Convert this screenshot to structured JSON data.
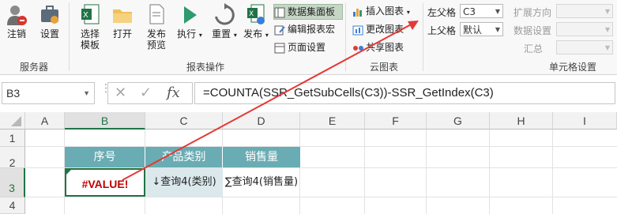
{
  "ribbon": {
    "groups": {
      "server": {
        "label": "服务器",
        "buttons": [
          "注销",
          "设置"
        ]
      },
      "report_ops": {
        "label": "报表操作",
        "buttons": [
          {
            "name": "select-template",
            "l1": "选择",
            "l2": "模板"
          },
          {
            "name": "open",
            "l1": "打开",
            "l2": ""
          },
          {
            "name": "publish-preview",
            "l1": "发布",
            "l2": "预览"
          },
          {
            "name": "run",
            "l1": "执行",
            "l2": ""
          },
          {
            "name": "reset",
            "l1": "重置",
            "l2": ""
          },
          {
            "name": "publish",
            "l1": "发布",
            "l2": ""
          }
        ],
        "small": [
          "数据集面板",
          "编辑报表宏",
          "页面设置"
        ]
      },
      "cloud_chart": {
        "label": "云图表",
        "small": [
          "插入图表",
          "更改图表",
          "共享图表"
        ]
      },
      "cell_settings": {
        "label": "单元格设置",
        "left_parent_label": "左父格",
        "left_parent_value": "C3",
        "top_parent_label": "上父格",
        "top_parent_value": "默认",
        "expand_label": "扩展方向",
        "data_settings_label": "数据设置",
        "summary_label": "汇总"
      }
    }
  },
  "formula_bar": {
    "name_box": "B3",
    "fx": "fx",
    "formula": "=COUNTA(SSR_GetSubCells(C3))-SSR_GetIndex(C3)"
  },
  "sheet": {
    "columns": [
      "A",
      "B",
      "C",
      "D",
      "E",
      "F",
      "G",
      "H",
      "I"
    ],
    "rows": [
      "1",
      "2",
      "3",
      "4"
    ],
    "header_cells": [
      "序号",
      "产品类别",
      "销售量"
    ],
    "b3": "#VALUE!",
    "c3": "↓查询4(类别)",
    "d3": "∑查询4(销售量)"
  },
  "colors": {
    "accent_green": "#217346",
    "header_teal": "#6aacb3",
    "error_red": "#c00000",
    "arrow_red": "#e53935"
  }
}
